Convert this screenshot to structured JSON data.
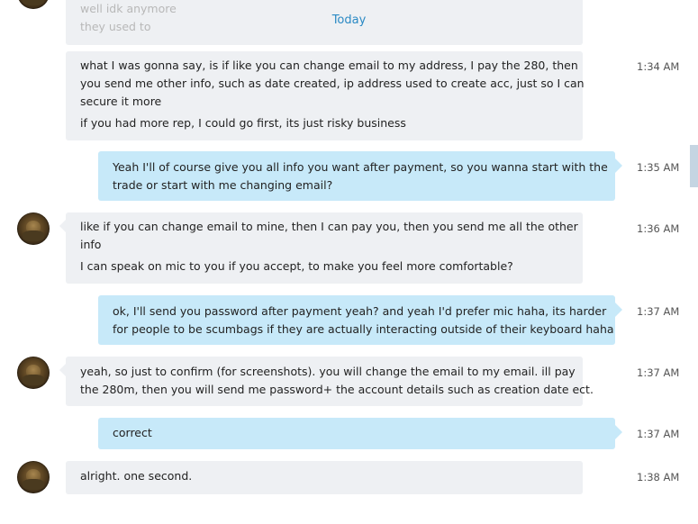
{
  "day_separator": "Today",
  "previous_message": {
    "lines": [
      "well idk anymore",
      "they used to"
    ]
  },
  "messages": [
    {
      "direction": "incoming",
      "avatar": false,
      "lines": [
        "what I was gonna say, is if like you can change email to my address, I pay the 280, then",
        "you send me other info, such as date created, ip address used to create acc, just so I can",
        "secure it more",
        "if you had more rep, I could go first, its just risky business"
      ],
      "time": "1:34 AM"
    },
    {
      "direction": "outgoing",
      "lines": [
        "Yeah I'll of course give you all info you want after payment, so you wanna start with the",
        "trade or start with me changing email?"
      ],
      "time": "1:35 AM"
    },
    {
      "direction": "incoming",
      "avatar": true,
      "lines": [
        "like if you can change email to mine, then I can pay you, then you send me all the other",
        "info",
        "I can speak on mic to you if you accept, to make you feel more comfortable?"
      ],
      "time": "1:36 AM"
    },
    {
      "direction": "outgoing",
      "lines": [
        "ok, I'll send you password after payment yeah? and yeah I'd prefer mic haha, its harder",
        "for people to be scumbags if they are actually interacting outside of their keyboard haha"
      ],
      "time": "1:37 AM"
    },
    {
      "direction": "incoming",
      "avatar": true,
      "lines": [
        "yeah, so just to confirm (for screenshots). you will change the email to my email. ill pay",
        "the 280m, then you will send me password+ the account details such as creation date ect."
      ],
      "time": "1:37 AM"
    },
    {
      "direction": "outgoing",
      "lines": [
        "correct"
      ],
      "time": "1:37 AM"
    },
    {
      "direction": "incoming",
      "avatar": true,
      "lines": [
        "alright. one second."
      ],
      "time": "1:38 AM"
    }
  ]
}
